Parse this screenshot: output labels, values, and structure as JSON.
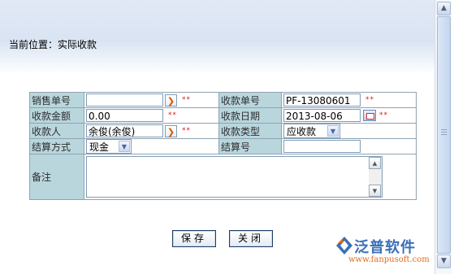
{
  "location": "当前位置：实际收款",
  "form": {
    "rows": [
      {
        "label_a": "销售单号",
        "value_a": "",
        "label_b": "收款单号",
        "value_b": "PF-13080601"
      },
      {
        "label_a": "收款金额",
        "value_a": "0.00",
        "label_b": "收款日期",
        "value_b": "2013-08-06"
      },
      {
        "label_a": "收款人",
        "value_a": "余俊(余俊)",
        "label_b": "收款类型",
        "value_b": "应收款"
      },
      {
        "label_a": "结算方式",
        "value_a": "现金",
        "label_b": "结算号",
        "value_b": ""
      },
      {
        "label_a": "备注",
        "value_a": ""
      }
    ],
    "required_mark": "**"
  },
  "buttons": {
    "save": "保存",
    "close": "关闭"
  },
  "logo": {
    "name": "泛普软件",
    "url": "www.fanpusoft.com"
  },
  "icons": {
    "lookup": "arrow-right-icon",
    "calendar": "calendar-icon",
    "dropdown": "chevron-down-icon"
  }
}
